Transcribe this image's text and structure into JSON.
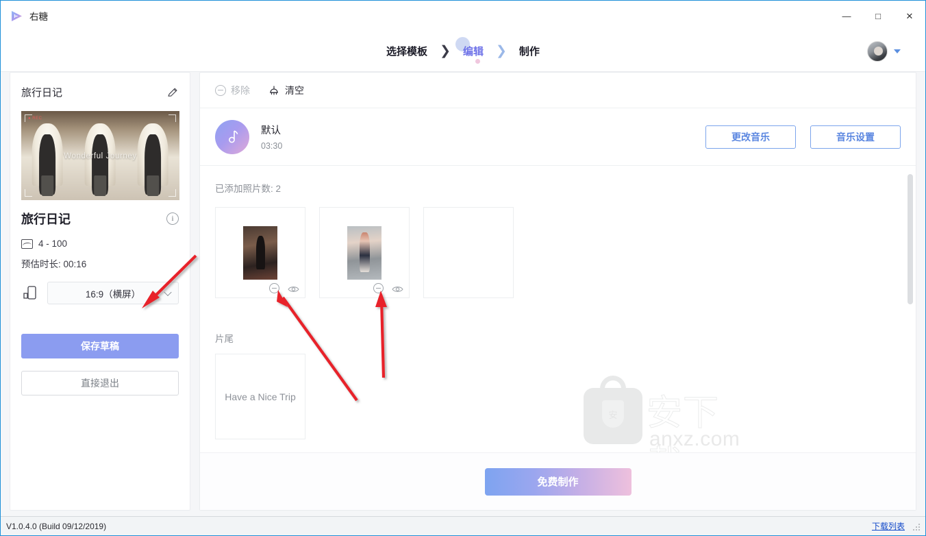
{
  "window": {
    "app_title": "右糖",
    "logo_icon": "play-triangle-icon",
    "minimize_glyph": "—",
    "maximize_glyph": "□",
    "close_glyph": "✕"
  },
  "steps": {
    "items": [
      {
        "label": "选择模板",
        "active": false
      },
      {
        "label": "编辑",
        "active": true
      },
      {
        "label": "制作",
        "active": false
      }
    ],
    "separator": "〉",
    "active_color": "#6f73e8"
  },
  "user": {
    "avatar_name": "user-avatar",
    "dropdown_icon": "chevron-down-icon"
  },
  "sidebar": {
    "title": "旅行日记",
    "edit_icon": "pencil-icon",
    "thumbnail_caption": "Wonderful Journey",
    "thumbnail_rec_label": "● REC",
    "project_name": "旅行日记",
    "info_icon": "info-icon",
    "photo_icon": "image-icon",
    "photo_range": "4 - 100",
    "duration_label": "预估时长: 00:16",
    "phone_icon": "phone-rotate-icon",
    "ratio_value": "16:9（横屏）",
    "ratio_caret_icon": "chevron-down-icon",
    "save_label": "保存草稿",
    "exit_label": "直接退出"
  },
  "main": {
    "toolbar": {
      "remove_label": "移除",
      "remove_icon": "minus-circle-icon",
      "remove_disabled": true,
      "clear_label": "清空",
      "clear_icon": "broom-icon"
    },
    "music": {
      "cover_icon": "music-note-icon",
      "name": "默认",
      "duration": "03:30",
      "change_label": "更改音乐",
      "settings_label": "音乐设置"
    },
    "photos": {
      "count_label": "已添加照片数: 2",
      "items": [
        {
          "name": "photo-1",
          "remove_icon": "minus-circle-icon",
          "preview_icon": "eye-icon"
        },
        {
          "name": "photo-2",
          "remove_icon": "minus-circle-icon",
          "preview_icon": "eye-icon"
        }
      ],
      "empty_slots": 1
    },
    "ending": {
      "section_label": "片尾",
      "card_text": "Have a Nice Trip"
    },
    "make_label": "免费制作"
  },
  "watermark": {
    "cn_text": "安下载",
    "shield_text": "安",
    "url_text": "anxz.com"
  },
  "statusbar": {
    "version": "V1.0.4.0 (Build 09/12/2019)",
    "download_list_label": "下载列表"
  }
}
